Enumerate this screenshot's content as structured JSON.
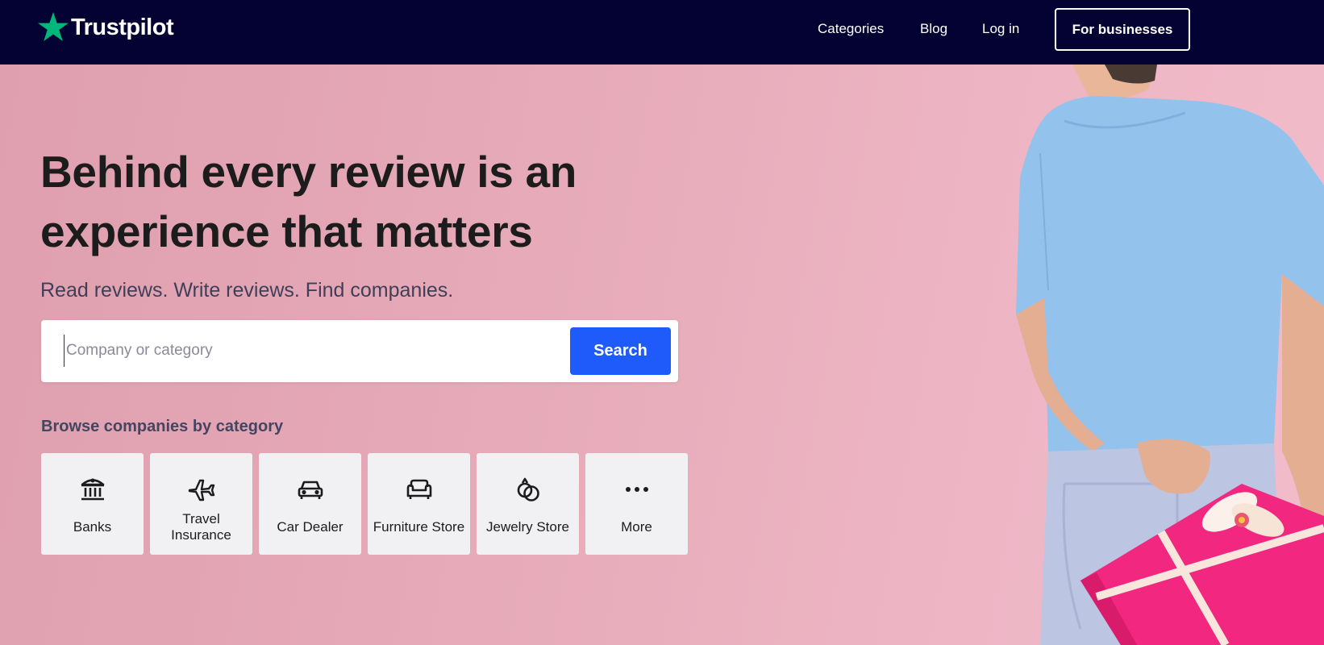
{
  "header": {
    "logo_text": "Trustpilot",
    "logo_star_color": "#00b67a",
    "background_color": "#040233",
    "nav": [
      {
        "label": "Categories"
      },
      {
        "label": "Blog"
      },
      {
        "label": "Log in"
      }
    ],
    "business_button_label": "For businesses"
  },
  "hero": {
    "background_color": "#e4a8b6",
    "headline": "Behind every review is an experience that matters",
    "subheadline": "Read reviews. Write reviews. Find companies.",
    "search": {
      "placeholder": "Company or category",
      "value": "",
      "button_label": "Search",
      "button_color": "#1f5bfa"
    },
    "browse_title": "Browse companies by category",
    "categories": [
      {
        "label": "Banks",
        "icon": "bank-icon"
      },
      {
        "label": "Travel Insurance",
        "icon": "airplane-icon"
      },
      {
        "label": "Car Dealer",
        "icon": "car-icon"
      },
      {
        "label": "Furniture Store",
        "icon": "sofa-icon"
      },
      {
        "label": "Jewelry Store",
        "icon": "rings-icon"
      },
      {
        "label": "More",
        "icon": "more-icon"
      }
    ]
  }
}
